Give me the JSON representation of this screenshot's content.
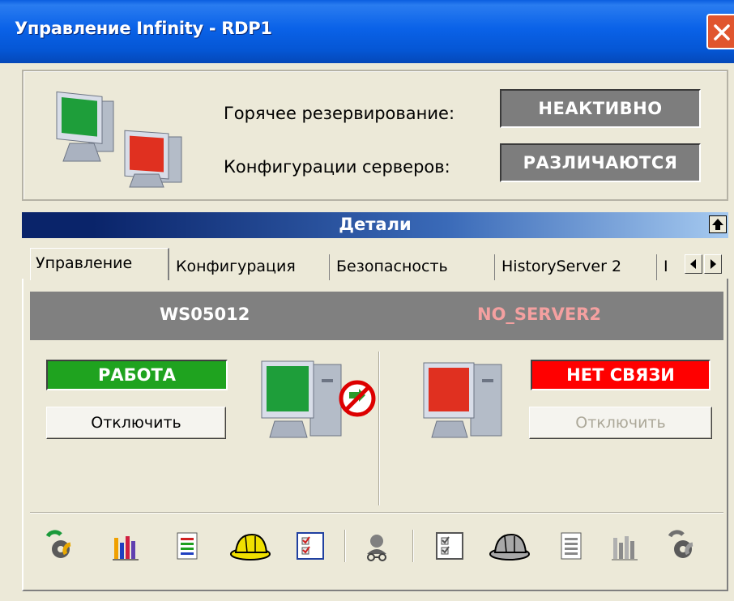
{
  "window": {
    "title": "Управление Infinity - RDP1"
  },
  "top": {
    "hot_standby_label": "Горячее резервирование:",
    "hot_standby_value": "НЕАКТИВНО",
    "server_config_label": "Конфигурации серверов:",
    "server_config_value": "РАЗЛИЧАЮТСЯ"
  },
  "details": {
    "title": "Детали"
  },
  "tabs": [
    {
      "label": "Управление",
      "active": true
    },
    {
      "label": "Конфигурация"
    },
    {
      "label": "Безопасность"
    },
    {
      "label": "HistoryServer 2"
    },
    {
      "label": "I"
    }
  ],
  "servers": {
    "left": {
      "name": "WS05012",
      "state": "РАБОТА",
      "state_color": "#1fa31f",
      "button": "Отключить"
    },
    "right": {
      "name": "NO_SERVER2",
      "name_color": "#f4a0a0",
      "state": "НЕТ СВЯЗИ",
      "state_color": "#ff0000",
      "button": "Отключить"
    }
  },
  "toolbar": {
    "icons": [
      "gear-refresh-icon",
      "bar-chart-icon",
      "document-icon",
      "hard-hat-icon",
      "checklist-icon",
      "network-user-icon",
      "checklist-icon",
      "hard-hat-icon",
      "document-icon",
      "bar-chart-icon",
      "gear-refresh-icon"
    ]
  },
  "colors": {
    "titlebar": "#0a5ee0",
    "status_box": "#7d7d7d",
    "header_bar": "#808080"
  }
}
